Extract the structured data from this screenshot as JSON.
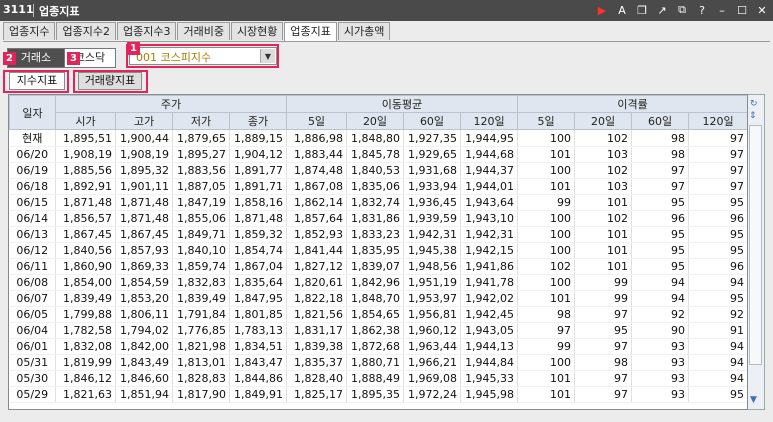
{
  "window": {
    "code": "3111",
    "title": "업종지표",
    "icons": [
      "play-icon",
      "font-icon",
      "copy-icon",
      "link-icon",
      "window-icon",
      "help-icon",
      "minimize-icon",
      "maximize-icon",
      "close-icon"
    ]
  },
  "tabs": [
    "업종지수",
    "업종지수2",
    "업종지수3",
    "거래비중",
    "시장현황",
    "업종지표",
    "시가총액"
  ],
  "active_tab": "업종지표",
  "toolbar": {
    "market_buttons": [
      "거래소",
      "코스닥"
    ],
    "combo_value": "001 코스피지수",
    "badges": [
      "1",
      "2",
      "3"
    ]
  },
  "subtabs": [
    "지수지표",
    "거래량지표"
  ],
  "table": {
    "group_headers": [
      "일자",
      "주가",
      "이동평균",
      "이격률"
    ],
    "sub_headers": [
      "시가",
      "고가",
      "저가",
      "종가",
      "5일",
      "20일",
      "60일",
      "120일",
      "5일",
      "20일",
      "60일",
      "120일"
    ],
    "rows": [
      [
        "현재",
        "1,895,51",
        "1,900,44",
        "1,879,65",
        "1,889,15",
        "1,886,98",
        "1,848,80",
        "1,927,35",
        "1,944,95",
        "100",
        "102",
        "98",
        "97"
      ],
      [
        "06/20",
        "1,908,19",
        "1,908,19",
        "1,895,27",
        "1,904,12",
        "1,883,44",
        "1,845,78",
        "1,929,65",
        "1,944,68",
        "101",
        "103",
        "98",
        "97"
      ],
      [
        "06/19",
        "1,885,56",
        "1,895,32",
        "1,883,56",
        "1,891,77",
        "1,874,48",
        "1,840,53",
        "1,931,68",
        "1,944,37",
        "100",
        "102",
        "97",
        "97"
      ],
      [
        "06/18",
        "1,892,91",
        "1,901,11",
        "1,887,05",
        "1,891,71",
        "1,867,08",
        "1,835,06",
        "1,933,94",
        "1,944,01",
        "101",
        "103",
        "97",
        "97"
      ],
      [
        "06/15",
        "1,871,48",
        "1,871,48",
        "1,847,19",
        "1,858,16",
        "1,862,14",
        "1,832,74",
        "1,936,45",
        "1,943,64",
        "99",
        "101",
        "95",
        "95"
      ],
      [
        "06/14",
        "1,856,57",
        "1,871,48",
        "1,855,06",
        "1,871,48",
        "1,857,64",
        "1,831,86",
        "1,939,59",
        "1,943,10",
        "100",
        "102",
        "96",
        "96"
      ],
      [
        "06/13",
        "1,867,45",
        "1,867,45",
        "1,849,71",
        "1,859,32",
        "1,852,93",
        "1,833,23",
        "1,942,31",
        "1,942,31",
        "100",
        "101",
        "95",
        "95"
      ],
      [
        "06/12",
        "1,840,56",
        "1,857,93",
        "1,840,10",
        "1,854,74",
        "1,841,44",
        "1,835,95",
        "1,945,38",
        "1,942,15",
        "100",
        "101",
        "95",
        "95"
      ],
      [
        "06/11",
        "1,860,90",
        "1,869,33",
        "1,859,74",
        "1,867,04",
        "1,827,12",
        "1,839,07",
        "1,948,56",
        "1,941,86",
        "102",
        "101",
        "95",
        "96"
      ],
      [
        "06/08",
        "1,854,00",
        "1,854,59",
        "1,832,83",
        "1,835,64",
        "1,820,61",
        "1,842,96",
        "1,951,19",
        "1,941,78",
        "100",
        "99",
        "94",
        "94"
      ],
      [
        "06/07",
        "1,839,49",
        "1,853,20",
        "1,839,49",
        "1,847,95",
        "1,822,18",
        "1,848,70",
        "1,953,97",
        "1,942,02",
        "101",
        "99",
        "94",
        "95"
      ],
      [
        "06/05",
        "1,799,88",
        "1,806,11",
        "1,791,84",
        "1,801,85",
        "1,821,56",
        "1,854,65",
        "1,956,81",
        "1,942,45",
        "98",
        "97",
        "92",
        "92"
      ],
      [
        "06/04",
        "1,782,58",
        "1,794,02",
        "1,776,85",
        "1,783,13",
        "1,831,17",
        "1,862,38",
        "1,960,12",
        "1,943,05",
        "97",
        "95",
        "90",
        "91"
      ],
      [
        "06/01",
        "1,832,08",
        "1,842,00",
        "1,821,98",
        "1,834,51",
        "1,839,38",
        "1,872,68",
        "1,963,44",
        "1,944,13",
        "99",
        "97",
        "93",
        "94"
      ],
      [
        "05/31",
        "1,819,99",
        "1,843,49",
        "1,813,01",
        "1,843,47",
        "1,835,37",
        "1,880,71",
        "1,966,21",
        "1,944,84",
        "100",
        "98",
        "93",
        "94"
      ],
      [
        "05/30",
        "1,846,12",
        "1,846,60",
        "1,828,83",
        "1,844,86",
        "1,828,40",
        "1,888,49",
        "1,969,08",
        "1,945,33",
        "101",
        "97",
        "93",
        "94"
      ],
      [
        "05/29",
        "1,821,63",
        "1,851,94",
        "1,817,90",
        "1,849,91",
        "1,825,17",
        "1,895,35",
        "1,972,24",
        "1,945,98",
        "101",
        "97",
        "93",
        "95"
      ]
    ]
  }
}
